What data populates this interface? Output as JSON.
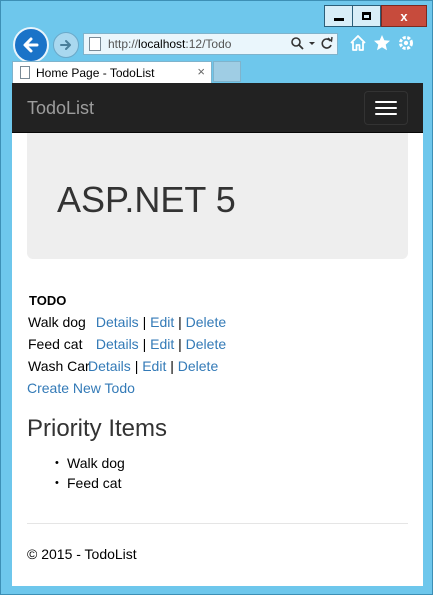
{
  "browser": {
    "url_prefix": "http://",
    "url_host": "localhost",
    "url_rest": ":12/Todo",
    "tab_title": "Home Page - TodoList",
    "tab_close": "×",
    "close_glyph": "x"
  },
  "site": {
    "brand": "TodoList",
    "hero": "ASP.NET 5",
    "todo_heading": "TODO",
    "todos": [
      {
        "name": "Walk dog",
        "details": "Details",
        "edit": "Edit",
        "delete": "Delete"
      },
      {
        "name": "Feed cat",
        "details": "Details",
        "edit": "Edit",
        "delete": "Delete"
      },
      {
        "name": "Wash Car",
        "details": "Details",
        "edit": "Edit",
        "delete": "Delete"
      }
    ],
    "separator": "|",
    "create_link": "Create New Todo",
    "priority_heading": "Priority Items",
    "priority_items": [
      "Walk dog",
      "Feed cat"
    ],
    "footer": "© 2015 - TodoList"
  },
  "colors": {
    "navbar": "#222222",
    "link": "#337ab7",
    "chrome": "#6ec7ec"
  }
}
